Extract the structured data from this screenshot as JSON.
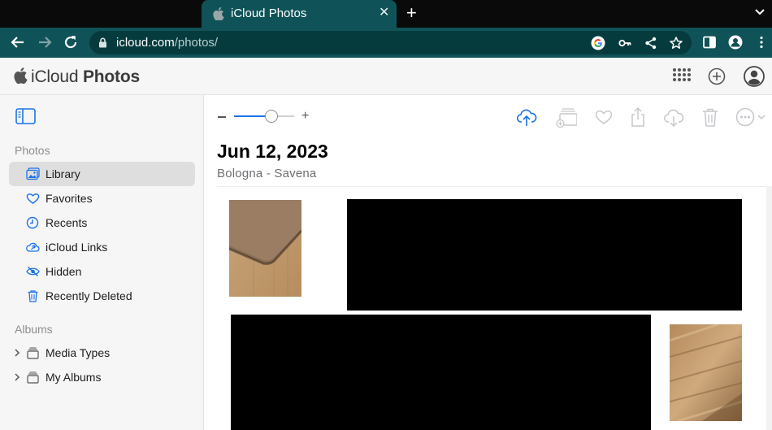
{
  "browser": {
    "tab_title": "iCloud Photos",
    "url_domain": "icloud.com",
    "url_path": "/photos/",
    "tab_close": "✕",
    "new_tab": "+"
  },
  "app": {
    "name_brand": "iCloud",
    "name_product": "Photos"
  },
  "sidebar": {
    "photos_section": "Photos",
    "albums_section": "Albums",
    "items": [
      {
        "label": "Library",
        "icon": "library-icon"
      },
      {
        "label": "Favorites",
        "icon": "heart-icon"
      },
      {
        "label": "Recents",
        "icon": "clock-icon"
      },
      {
        "label": "iCloud Links",
        "icon": "cloud-link-icon"
      },
      {
        "label": "Hidden",
        "icon": "eye-slash-icon"
      },
      {
        "label": "Recently Deleted",
        "icon": "trash-icon"
      }
    ],
    "albums": [
      {
        "label": "Media Types",
        "icon": "album-stack-icon"
      },
      {
        "label": "My Albums",
        "icon": "album-stack-icon"
      }
    ]
  },
  "main": {
    "zoom_plus": "+",
    "date": "Jun 12, 2023",
    "location": "Bologna - Savena",
    "zoom_level": 0.62
  },
  "colors": {
    "accent": "#1a73e8",
    "chrome_dark": "#0f5257",
    "sidebar_bg": "#f6f6f6"
  }
}
